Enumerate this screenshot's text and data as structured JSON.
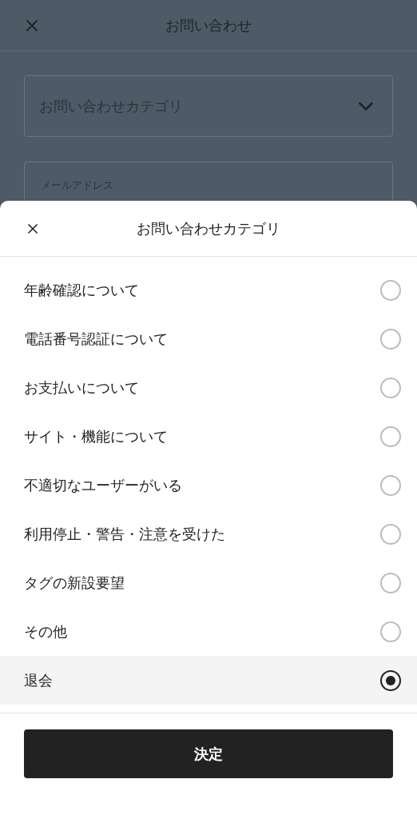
{
  "header": {
    "title": "お問い合わせ"
  },
  "form": {
    "category_placeholder": "お問い合わせカテゴリ",
    "email_label": "メールアドレス"
  },
  "sheet": {
    "title": "お問い合わせカテゴリ",
    "options": [
      {
        "label": "年齢確認について",
        "selected": false
      },
      {
        "label": "電話番号認証について",
        "selected": false
      },
      {
        "label": "お支払いについて",
        "selected": false
      },
      {
        "label": "サイト・機能について",
        "selected": false
      },
      {
        "label": "不適切なユーザーがいる",
        "selected": false
      },
      {
        "label": "利用停止・警告・注意を受けた",
        "selected": false
      },
      {
        "label": "タグの新設要望",
        "selected": false
      },
      {
        "label": "その他",
        "selected": false
      },
      {
        "label": "退会",
        "selected": true
      }
    ],
    "confirm_button": "決定"
  }
}
